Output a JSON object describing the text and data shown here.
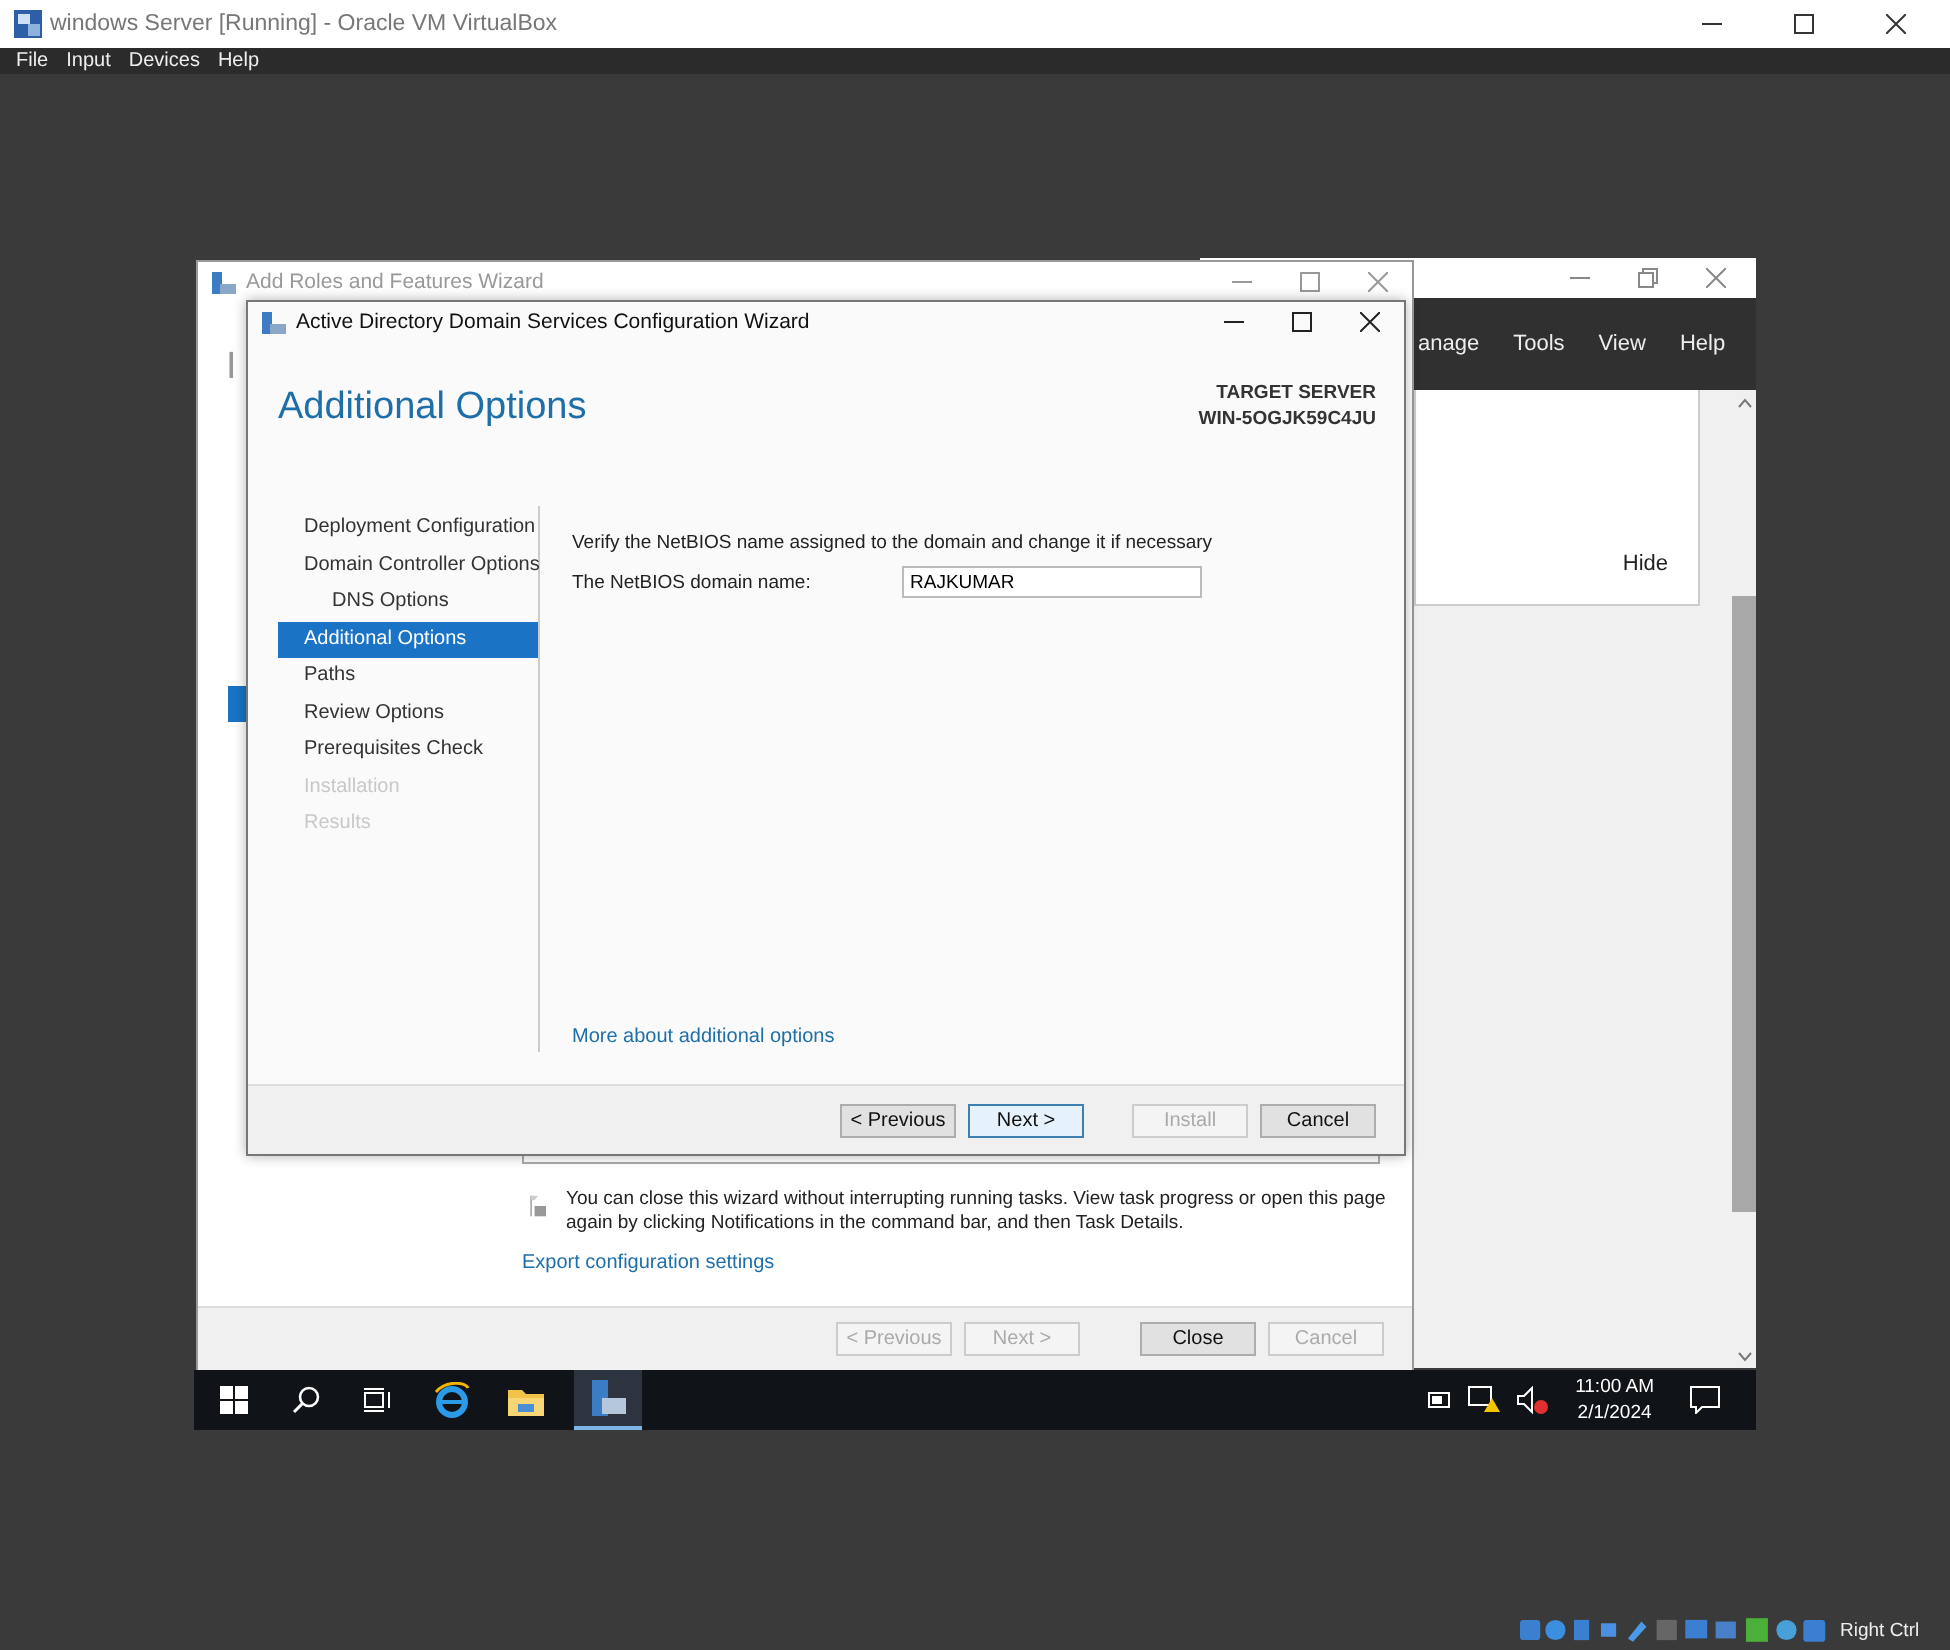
{
  "host_window": {
    "title": "windows Server [Running] - Oracle VM VirtualBox",
    "menu": [
      "File",
      "Input",
      "Devices",
      "Help"
    ],
    "host_key": "Right Ctrl"
  },
  "server_manager": {
    "menu": [
      "anage",
      "Tools",
      "View",
      "Help"
    ],
    "hide_link": "Hide"
  },
  "add_roles_wizard": {
    "title": "Add Roles and Features Wizard",
    "heading_fragment": "I",
    "notice": "You can close this wizard without interrupting running tasks. View task progress or open this page again by clicking Notifications in the command bar, and then Task Details.",
    "export_link": "Export configuration settings",
    "buttons": [
      {
        "label": "< Previous",
        "disabled": true,
        "default": false
      },
      {
        "label": "Next >",
        "disabled": true,
        "default": false
      },
      {
        "label": "Close",
        "disabled": false,
        "default": false
      },
      {
        "label": "Cancel",
        "disabled": true,
        "default": false
      }
    ]
  },
  "adds_wizard": {
    "title": "Active Directory Domain Services Configuration Wizard",
    "heading": "Additional Options",
    "target_server_label": "TARGET SERVER",
    "target_server_name": "WIN-5OGJK59C4JU",
    "steps": [
      {
        "label": "Deployment Configuration",
        "selected": false,
        "disabled": false
      },
      {
        "label": "Domain Controller Options",
        "selected": false,
        "disabled": false,
        "children": [
          {
            "label": "DNS Options",
            "selected": false,
            "disabled": false
          }
        ]
      },
      {
        "label": "Additional Options",
        "selected": true,
        "disabled": false
      },
      {
        "label": "Paths",
        "selected": false,
        "disabled": false
      },
      {
        "label": "Review Options",
        "selected": false,
        "disabled": false
      },
      {
        "label": "Prerequisites Check",
        "selected": false,
        "disabled": false
      },
      {
        "label": "Installation",
        "selected": false,
        "disabled": true
      },
      {
        "label": "Results",
        "selected": false,
        "disabled": true
      }
    ],
    "prompt": "Verify the NetBIOS name assigned to the domain and change it if necessary",
    "field_label": "The NetBIOS domain name:",
    "field_value": "RAJKUMAR",
    "help_link": "More about additional options",
    "buttons": [
      {
        "label": "< Previous",
        "disabled": false,
        "default": false
      },
      {
        "label": "Next >",
        "disabled": false,
        "default": true
      },
      {
        "label": "Install",
        "disabled": true,
        "default": false
      },
      {
        "label": "Cancel",
        "disabled": false,
        "default": false
      }
    ]
  },
  "taskbar": {
    "time": "11:00 AM",
    "date": "2/1/2024"
  }
}
